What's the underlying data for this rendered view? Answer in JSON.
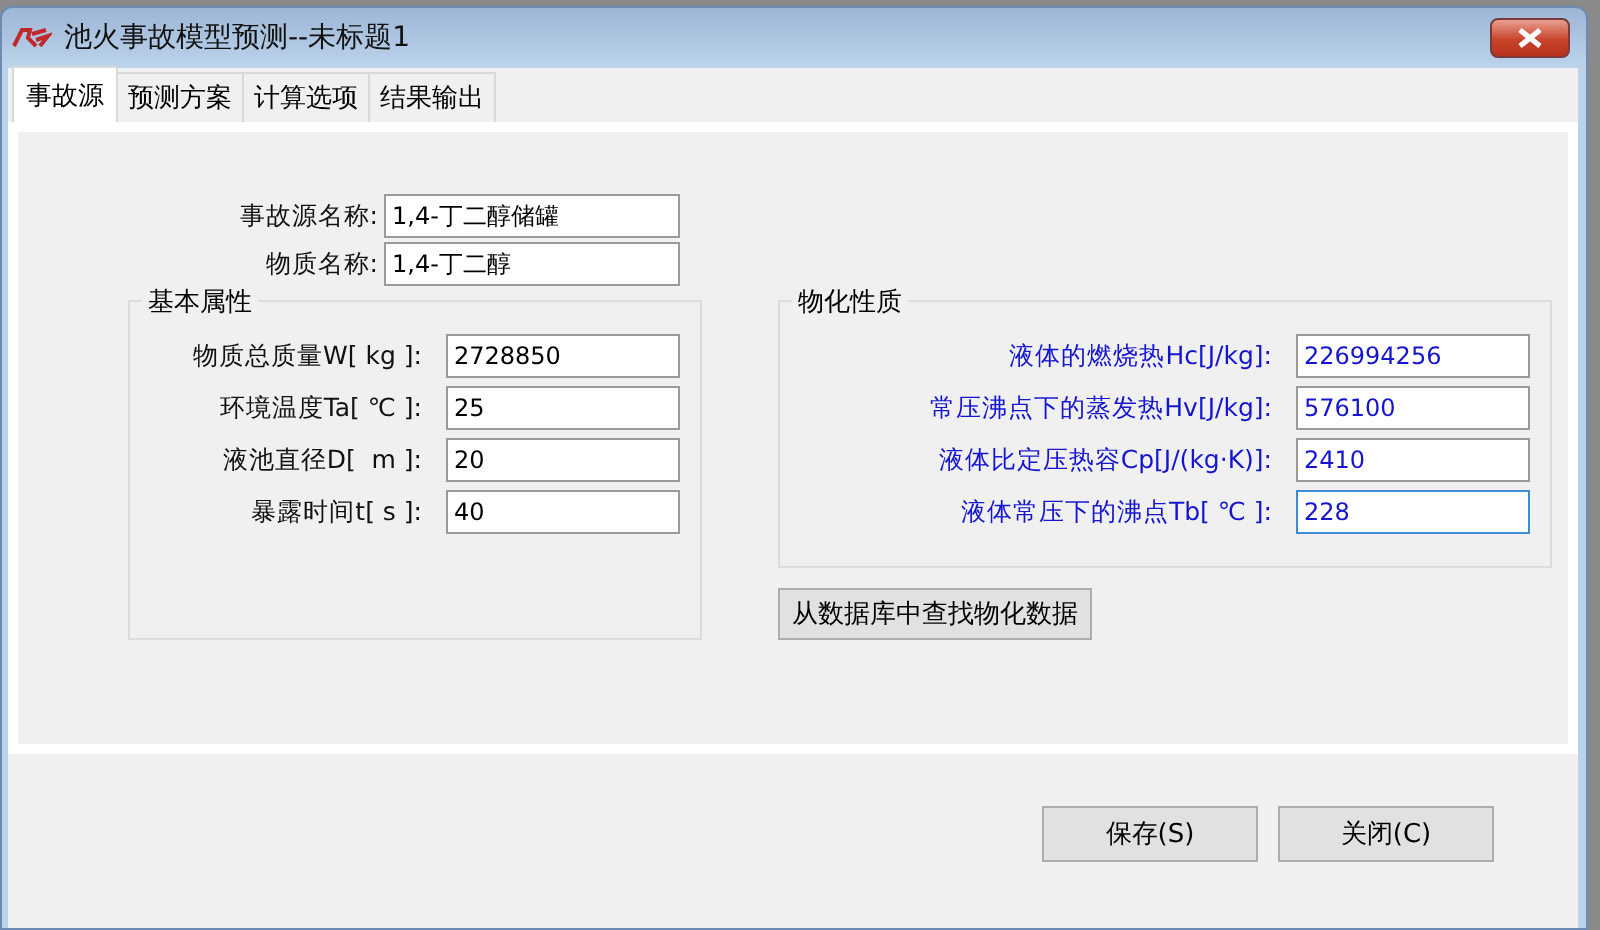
{
  "window": {
    "title": "池火事故模型预测--未标题1"
  },
  "tabs": [
    {
      "label": "事故源",
      "selected": true
    },
    {
      "label": "预测方案",
      "selected": false
    },
    {
      "label": "计算选项",
      "selected": false
    },
    {
      "label": "结果输出",
      "selected": false
    }
  ],
  "source": {
    "fields": [
      {
        "label": "事故源名称:",
        "value": "1,4-丁二醇储罐"
      },
      {
        "label": "物质名称:",
        "value": "1,4-丁二醇"
      }
    ]
  },
  "basic": {
    "title": "基本属性",
    "fields": [
      {
        "label": "物质总质量W[ kg ]:",
        "value": "2728850",
        "focused": false
      },
      {
        "label": "环境温度Ta[ ℃ ]:",
        "value": "25",
        "focused": false
      },
      {
        "label": "液池直径D[  m ]:",
        "value": "20",
        "focused": false
      },
      {
        "label": "暴露时间t[ s ]:",
        "value": "40",
        "focused": false
      }
    ]
  },
  "physical": {
    "title": "物化性质",
    "fields": [
      {
        "label": "液体的燃烧热Hc[J/kg]:",
        "value": "226994256",
        "focused": false
      },
      {
        "label": "常压沸点下的蒸发热Hv[J/kg]:",
        "value": "576100",
        "focused": false
      },
      {
        "label": "液体比定压热容Cp[J/(kg·K)]:",
        "value": "2410",
        "focused": false
      },
      {
        "label": "液体常压下的沸点Tb[ ℃ ]:",
        "value": "228",
        "focused": true
      }
    ],
    "lookup_button": "从数据库中查找物化数据"
  },
  "buttons": [
    "保存(S)",
    "关闭(C)"
  ]
}
